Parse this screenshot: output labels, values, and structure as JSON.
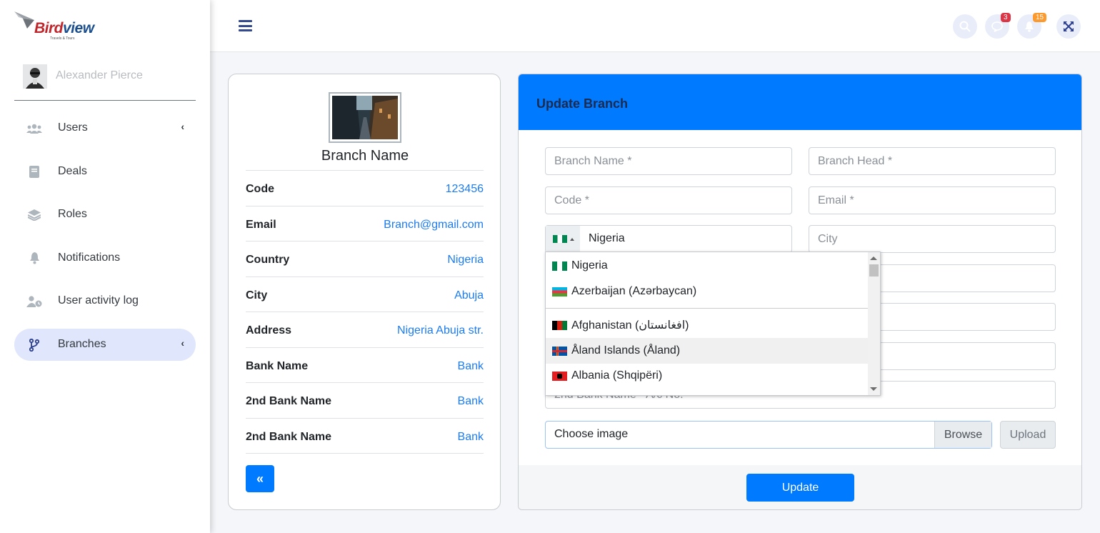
{
  "brand": {
    "name_part1": "Bird",
    "name_part2": "view",
    "tagline": "Travels & Tours"
  },
  "user": {
    "name": "Alexander Pierce"
  },
  "sidebar": {
    "items": [
      {
        "label": "Users",
        "icon": "users-icon",
        "has_arrow": true
      },
      {
        "label": "Deals",
        "icon": "book-icon",
        "has_arrow": false
      },
      {
        "label": "Roles",
        "icon": "layers-icon",
        "has_arrow": false
      },
      {
        "label": "Notifications",
        "icon": "bell-icon",
        "has_arrow": false
      },
      {
        "label": "User activity log",
        "icon": "user-clock-icon",
        "has_arrow": false
      },
      {
        "label": "Branches",
        "icon": "code-branch-icon",
        "has_arrow": true,
        "active": true
      }
    ],
    "arrow": "‹"
  },
  "topbar": {
    "messages_badge": "3",
    "notifications_badge": "15"
  },
  "profile": {
    "title": "Branch Name",
    "rows": [
      {
        "key": "Code",
        "value": "123456"
      },
      {
        "key": "Email",
        "value": "Branch@gmail.com"
      },
      {
        "key": "Country",
        "value": "Nigeria"
      },
      {
        "key": "City",
        "value": "Abuja"
      },
      {
        "key": "Address",
        "value": "Nigeria Abuja str."
      },
      {
        "key": "Bank Name",
        "value": "Bank"
      },
      {
        "key": "2nd Bank Name",
        "value": "Bank"
      },
      {
        "key": "2nd Bank Name",
        "value": "Bank"
      }
    ],
    "back_label": "«"
  },
  "form": {
    "title": "Update Branch",
    "branch_name_placeholder": "Branch Name *",
    "branch_head_placeholder": "Branch Head *",
    "code_placeholder": "Code *",
    "email_placeholder": "Email *",
    "phone_country_value": "Nigeria",
    "city_placeholder": "City",
    "partial_field_text": "2nd Bank Name - A/c No.",
    "file_label": "Choose image",
    "browse_label": "Browse",
    "upload_label": "Upload",
    "update_label": "Update"
  },
  "country_dropdown": {
    "preferred": [
      {
        "label": "Nigeria",
        "flag": "nigeria-flag"
      },
      {
        "label": "Azerbaijan (Azərbaycan)",
        "flag": "azerbaijan-flag"
      }
    ],
    "countries": [
      {
        "label": "Afghanistan (‫افغانستان‬‎)",
        "flag": "afghanistan-flag"
      },
      {
        "label": "Åland Islands (Åland)",
        "flag": "aland-flag",
        "highlighted": true
      },
      {
        "label": "Albania (Shqipëri)",
        "flag": "albania-flag"
      }
    ]
  },
  "colors": {
    "primary": "#007bff",
    "link": "#1c7cf2",
    "nav_active_bg": "#e0e6fb"
  }
}
